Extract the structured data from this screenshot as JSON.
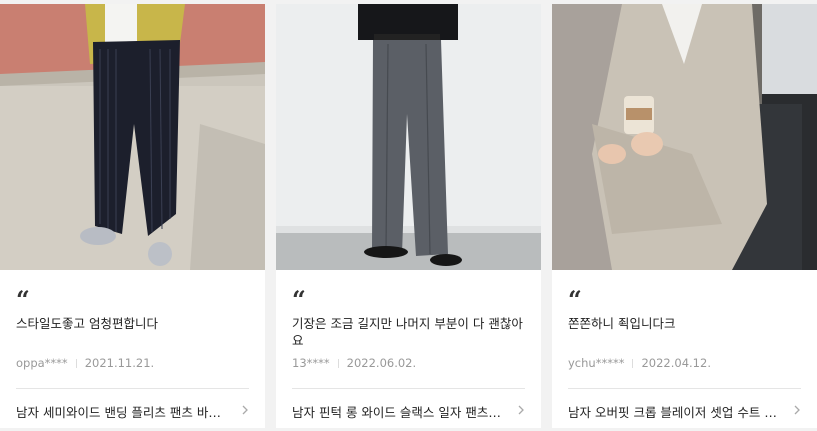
{
  "cards": [
    {
      "quote_mark": "“",
      "review": "스타일도좋고 엄청편합니다",
      "user": "oppa****",
      "date": "2021.11.21.",
      "product": "남자 세미와이드 밴딩 플리츠 팬츠 바지 가을 겨울 봄"
    },
    {
      "quote_mark": "“",
      "review": "기장은 조금 길지만 나머지 부분이 다 괜찮아요",
      "user": "13****",
      "date": "2022.06.02.",
      "product": "남자 핀턱 롱 와이드 슬랙스 일자 팬츠 회색"
    },
    {
      "quote_mark": "“",
      "review": "쫀쫀하니 죅입니다크",
      "user": "ychu*****",
      "date": "2022.04.12.",
      "product": "남자 오버핏 크롭 블레이저 셋업 수트 미니멀"
    }
  ],
  "icons": {
    "chevron": "chevron-right-icon",
    "quote": "quote-icon"
  },
  "colors": {
    "background": "#f2f2f2",
    "card": "#ffffff",
    "meta_text": "#999999"
  }
}
